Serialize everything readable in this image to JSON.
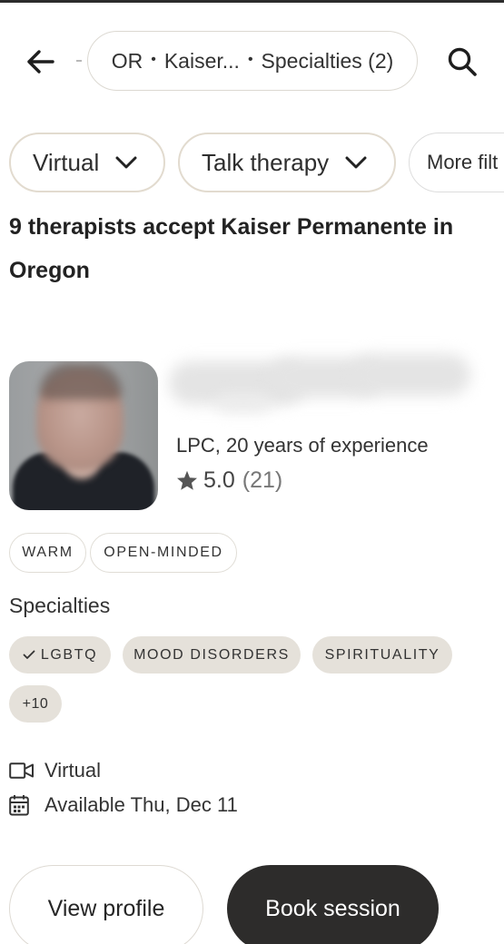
{
  "header": {
    "breadcrumb": {
      "state": "OR",
      "insurance": "Kaiser...",
      "specialties": "Specialties (2)"
    }
  },
  "filters": [
    {
      "label": "Virtual"
    },
    {
      "label": "Talk therapy"
    },
    {
      "label": "More filt"
    }
  ],
  "results": {
    "heading": "9 therapists accept Kaiser Permanente in Oregon"
  },
  "therapist": {
    "credentials": "LPC, 20 years of experience",
    "rating": "5.0",
    "review_count": "(21)",
    "traits": [
      "WARM",
      "OPEN-MINDED"
    ],
    "specialties_label": "Specialties",
    "specialties": [
      "LGBTQ",
      "MOOD DISORDERS",
      "SPIRITUALITY"
    ],
    "more_specialties": "+10",
    "session_type": "Virtual",
    "availability": "Available Thu, Dec 11"
  },
  "actions": {
    "view_profile": "View profile",
    "book_session": "Book session"
  },
  "icons": {
    "back": "arrow-left-icon",
    "search": "search-icon",
    "chevron": "chevron-down-icon",
    "star": "star-icon",
    "check": "check-icon",
    "video": "video-camera-icon",
    "calendar": "calendar-icon"
  },
  "colors": {
    "pill_border": "#e2dbcf",
    "chip_bg": "#e5e1da",
    "primary_button": "#2d2c2b",
    "star": "#555555"
  }
}
